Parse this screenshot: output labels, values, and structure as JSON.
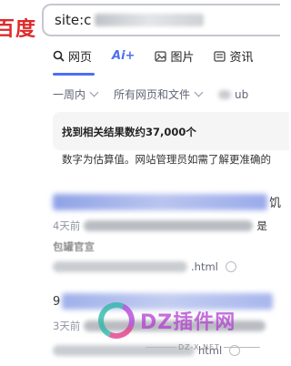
{
  "logo": "百度",
  "search": {
    "query_prefix": "site:c"
  },
  "tabs": [
    {
      "label": "网页",
      "icon": "search-icon",
      "active": true
    },
    {
      "label": "Ai+",
      "icon": "ai-icon",
      "active": false
    },
    {
      "label": "图片",
      "icon": "image-icon",
      "active": false
    },
    {
      "label": "资讯",
      "icon": "news-icon",
      "active": false
    }
  ],
  "filters": [
    {
      "label": "一周内"
    },
    {
      "label": "所有网页和文件"
    },
    {
      "label": "ub"
    }
  ],
  "info": {
    "count": "找到相关结果数约37,000个",
    "estimate": "数字为估算值。网站管理员如需了解更准确的"
  },
  "results": [
    {
      "title_tail": "饥",
      "meta_prefix": "4天前",
      "meta_tail": "是",
      "snippet_tail": "包罐官宣",
      "url_tail": ".html"
    },
    {
      "title_prefix": "9",
      "meta_prefix": "3天前",
      "url_tail": "html"
    }
  ],
  "watermark": {
    "text": "DZ插件网",
    "sub": "DZ-X.NET"
  },
  "colors": {
    "accent": "#4e6ef2",
    "logo_red": "#de2a2a"
  }
}
